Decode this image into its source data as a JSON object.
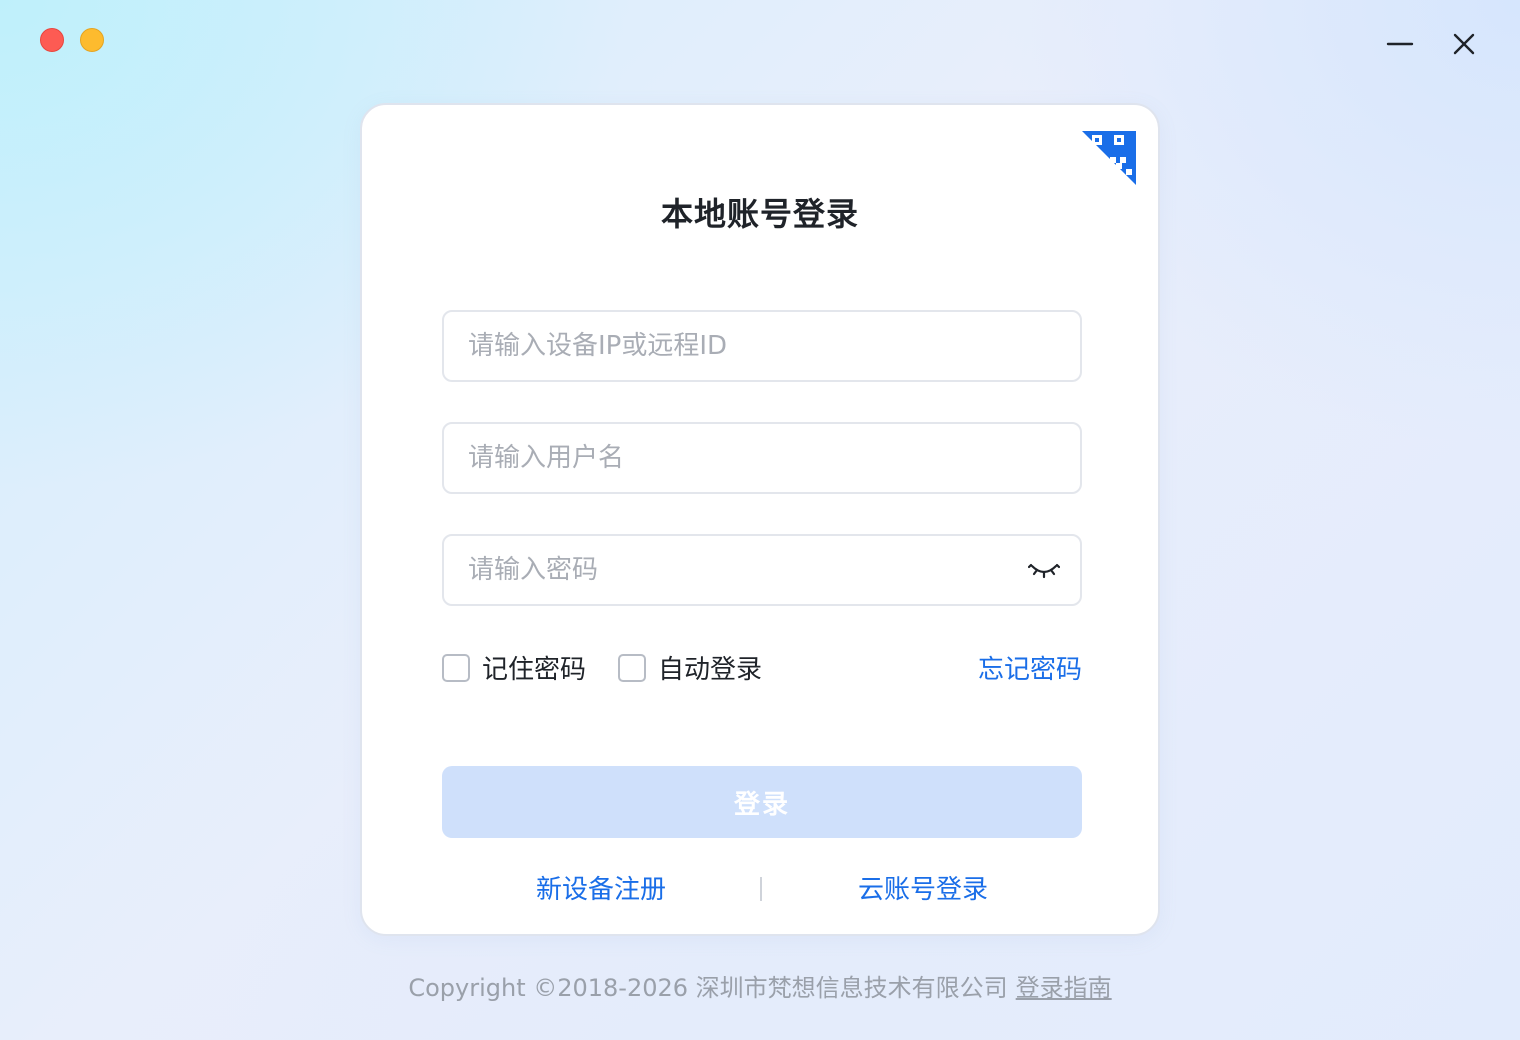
{
  "window": {
    "controls": {
      "minimize_icon": "minimize-icon",
      "close_icon": "close-icon"
    }
  },
  "login": {
    "title": "本地账号登录",
    "qr_icon": "qr-code-icon",
    "ip_placeholder": "请输入设备IP或远程ID",
    "username_placeholder": "请输入用户名",
    "password_placeholder": "请输入密码",
    "password_toggle_icon": "eye-closed-icon",
    "remember_label": "记住密码",
    "auto_login_label": "自动登录",
    "forgot_label": "忘记密码",
    "submit_label": "登录",
    "register_label": "新设备注册",
    "cloud_login_label": "云账号登录"
  },
  "footer": {
    "copyright": "Copyright ©2018-2026 深圳市梵想信息技术有限公司",
    "guide_label": "登录指南"
  },
  "colors": {
    "accent": "#1a6ee8",
    "button_disabled": "#cfe0fb",
    "traffic_red": "#fd5b53",
    "traffic_yellow": "#fdbb2e"
  }
}
